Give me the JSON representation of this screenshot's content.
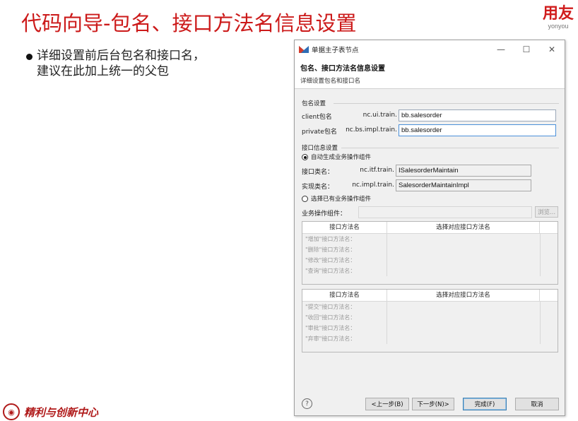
{
  "slide": {
    "title": "代码向导-包名、接口方法名信息设置",
    "brand_main": "用友",
    "brand_sub": "yonyou",
    "bullet_lines": [
      "详细设置前后台包名和接口名，",
      "建议在此加上统一的父包"
    ],
    "footer_text": "精利与创新中心"
  },
  "dialog": {
    "window_title": "单据主子表节点",
    "controls": [
      "—",
      "☐",
      "✕"
    ],
    "banner_title": "包名、接口方法名信息设置",
    "banner_desc": "详细设置包名和接口名",
    "package_group": {
      "label": "包名设置",
      "client_label": "client包名",
      "client_prefix": "nc.ui.train.",
      "client_value": "bb.salesorder",
      "private_label": "private包名",
      "private_prefix": "nc.bs.impl.train.",
      "private_value": "bb.salesorder"
    },
    "interface_group": {
      "label": "接口信息设置",
      "radio_auto": "自动生成业务操作组件",
      "interface_class_label": "接口类名：",
      "interface_prefix": "nc.itf.train.",
      "interface_value": "ISalesorderMaintain",
      "impl_class_label": "实现类名：",
      "impl_prefix": "nc.impl.train.",
      "impl_value": "SalesorderMaintainImpl",
      "radio_existing": "选择已有业务操作组件",
      "component_label": "业务操作组件：",
      "browse_label": "浏览..."
    },
    "table1": {
      "col1": "接口方法名",
      "col2": "选择对应接口方法名",
      "rows": [
        "\"增加\"接口方法名：",
        "\"删除\"接口方法名：",
        "\"修改\"接口方法名：",
        "\"查询\"接口方法名："
      ]
    },
    "table2": {
      "col1": "接口方法名",
      "col2": "选择对应接口方法名",
      "rows": [
        "\"提交\"接口方法名：",
        "\"收回\"接口方法名：",
        "\"审批\"接口方法名：",
        "\"弃审\"接口方法名："
      ]
    },
    "buttons": {
      "help": "?",
      "back": "<上一步(B)",
      "next": "下一步(N)>",
      "finish": "完成(F)",
      "cancel": "取消"
    }
  },
  "colors": {
    "title_red": "#cc1a1a",
    "dialog_bg": "#f0f0f0",
    "focus_blue": "#4a90d9"
  }
}
